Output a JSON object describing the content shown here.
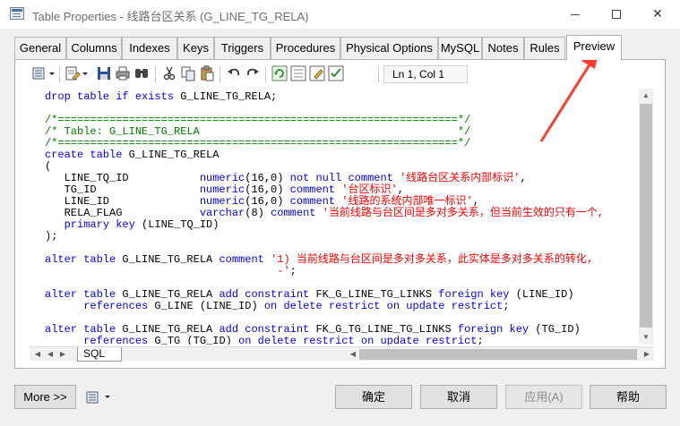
{
  "window": {
    "title": "Table Properties - 线路台区关系 (G_LINE_TG_RELA)",
    "minimize_icon": "minimize-icon",
    "maximize_icon": "maximize-icon",
    "close_icon": "close-icon",
    "close_glyph": "✕"
  },
  "tabs": [
    "General",
    "Columns",
    "Indexes",
    "Keys",
    "Triggers",
    "Procedures",
    "Physical Options",
    "MySQL",
    "Notes",
    "Rules",
    "Preview"
  ],
  "active_tab": "Preview",
  "toolbar": {
    "icons": [
      "script-options-icon",
      "dropdown-icon",
      "properties-icon",
      "dropdown-icon",
      "save-icon",
      "print-icon",
      "find-icon",
      "cut-icon",
      "copy-icon",
      "paste-icon",
      "undo-icon",
      "redo-icon",
      "refresh-icon",
      "tick-icon",
      "edit-icon",
      "checklist-icon"
    ],
    "position": "Ln 1, Col 1"
  },
  "sql_tab": "SQL",
  "buttons": {
    "more": "More >>",
    "ok": "确定",
    "cancel": "取消",
    "apply": "应用(A)",
    "help": "帮助"
  },
  "colors": {
    "keyword": "#0000ff",
    "comment": "#008000",
    "string": "#ff0000",
    "annotation_arrow": "#ff3b30"
  }
}
